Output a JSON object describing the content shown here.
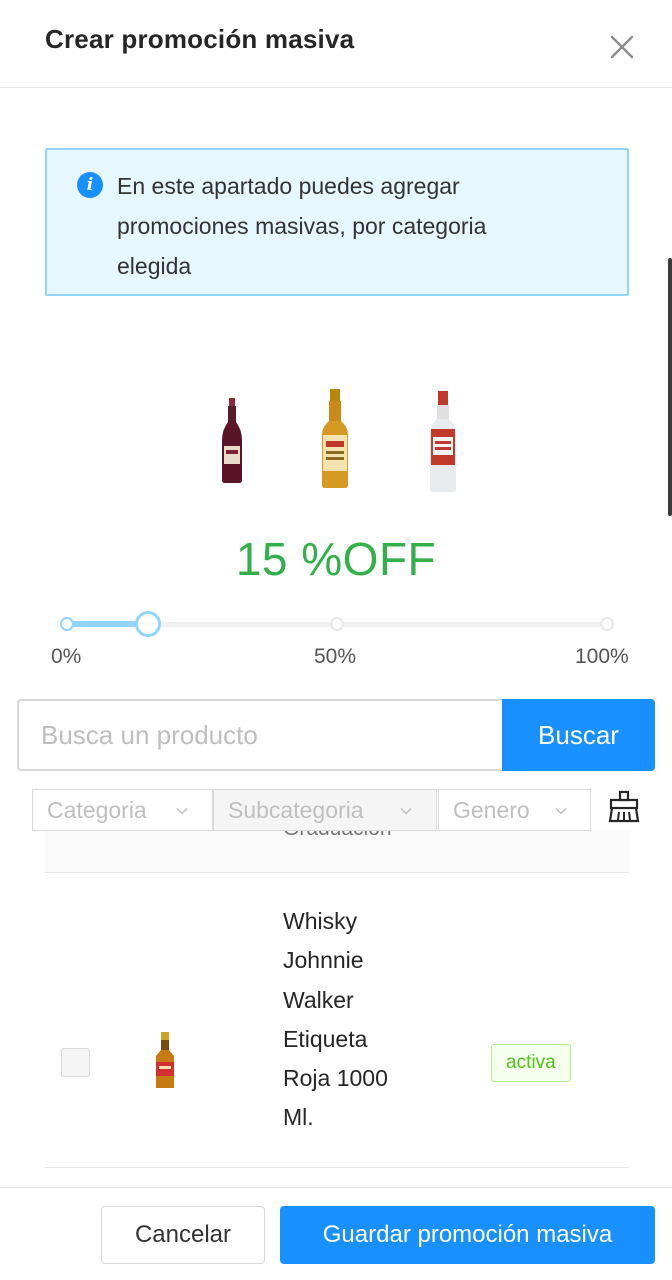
{
  "modal": {
    "title": "Crear promoción masiva",
    "close_icon": "close-icon"
  },
  "info": {
    "icon": "info-circle-icon",
    "line1": "En este apartado puedes agregar",
    "line2": "promociones masivas, por categoria",
    "line3": "elegida"
  },
  "promo": {
    "percent_label": "15 %OFF",
    "discount_percent": 15,
    "slider_marks": [
      "0%",
      "50%",
      "100%"
    ]
  },
  "search": {
    "placeholder": "Busca un producto",
    "button_label": "Buscar"
  },
  "filters": {
    "category_placeholder": "Categoria",
    "subcategory_placeholder": "Subcategoria",
    "genre_placeholder": "Genero",
    "clear_icon": "clear-broom-icon"
  },
  "products": [
    {
      "name_lines": [
        "Whisky",
        "Johnnie",
        "Walker",
        "Etiqueta",
        "Roja 1000",
        "Ml."
      ],
      "status": "activa",
      "status_color": "#52c41a"
    }
  ],
  "footer": {
    "cancel_label": "Cancelar",
    "save_label": "Guardar promoción masiva"
  },
  "colors": {
    "primary": "#1890ff",
    "promo_green": "#33b04a",
    "info_bg": "#e6f7ff",
    "slider_track": "#91d5ff"
  }
}
